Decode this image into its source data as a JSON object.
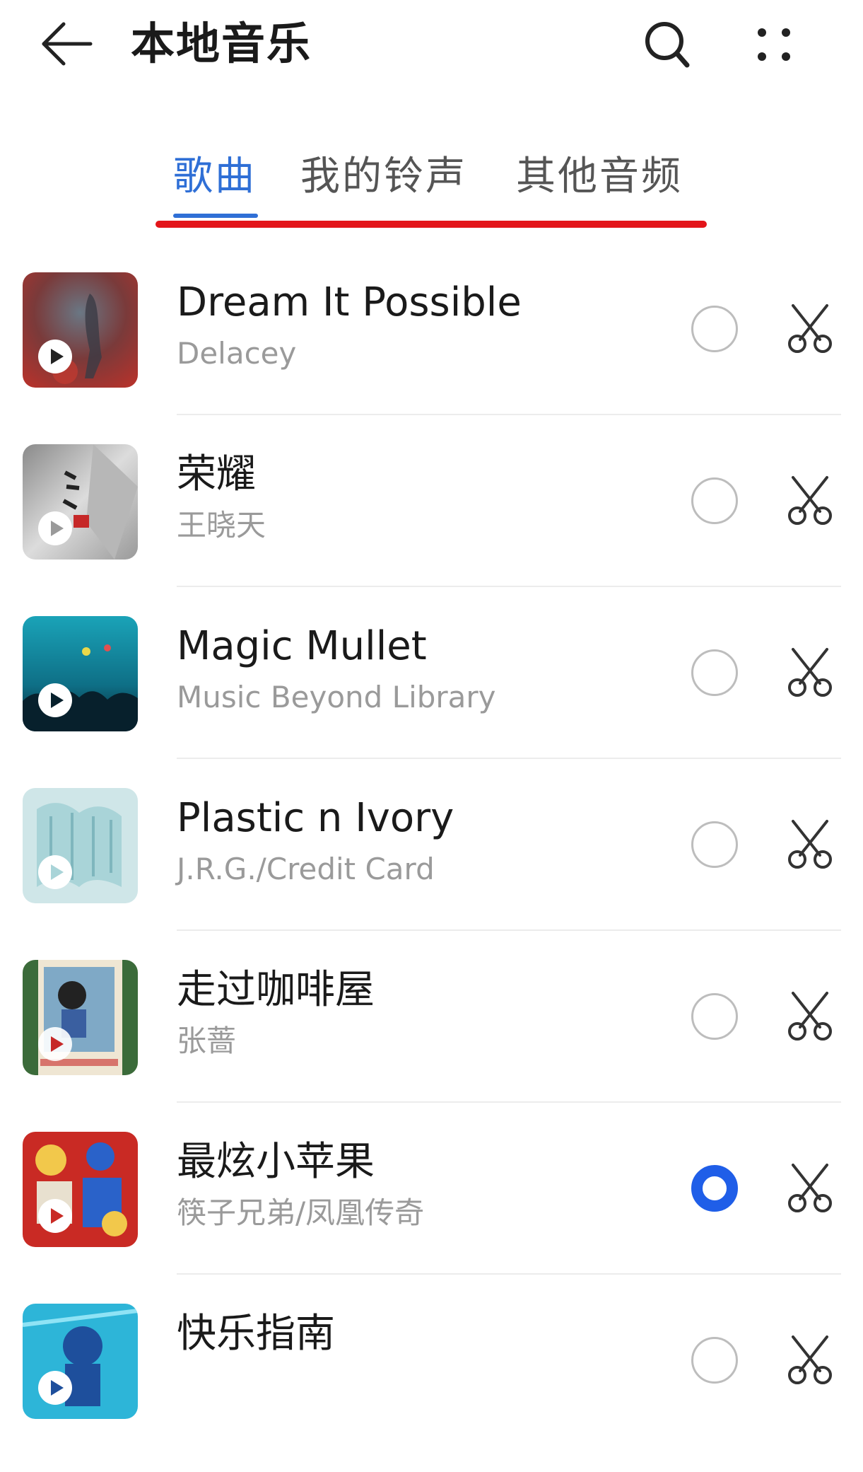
{
  "header": {
    "title": "本地音乐"
  },
  "tabs": [
    {
      "label": "歌曲",
      "active": true
    },
    {
      "label": "我的铃声",
      "active": false
    },
    {
      "label": "其他音频",
      "active": false
    }
  ],
  "colors": {
    "accent": "#2f6fd6",
    "radio_selected": "#1f5ee8",
    "annotation_red": "#e3151a"
  },
  "songs": [
    {
      "title": "Dream It Possible",
      "artist": "Delacey",
      "selected": false
    },
    {
      "title": "荣耀",
      "artist": "王晓天",
      "selected": false
    },
    {
      "title": "Magic Mullet",
      "artist": "Music Beyond Library",
      "selected": false
    },
    {
      "title": "Plastic n Ivory",
      "artist": "J.R.G./Credit Card",
      "selected": false
    },
    {
      "title": "走过咖啡屋",
      "artist": "张蔷",
      "selected": false
    },
    {
      "title": "最炫小苹果",
      "artist": "筷子兄弟/凤凰传奇",
      "selected": true
    },
    {
      "title": "快乐指南",
      "artist": "",
      "selected": false
    }
  ]
}
